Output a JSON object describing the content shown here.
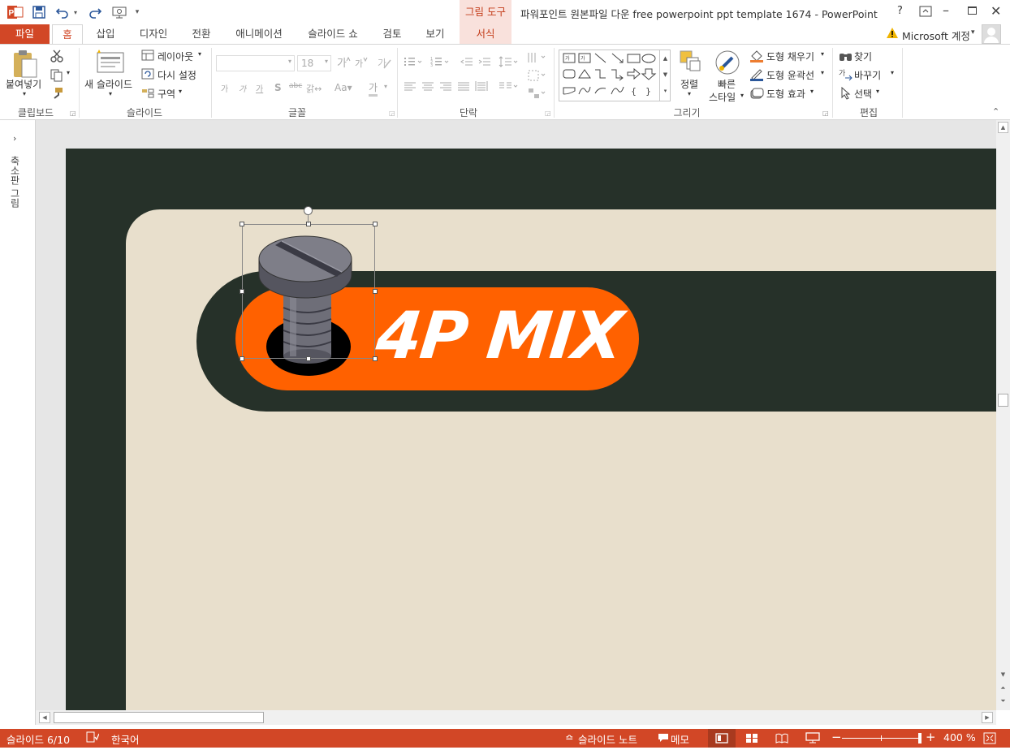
{
  "app": {
    "title": "파워포인트 원본파일 다운 free powerpoint ppt template 1674 - PowerPoint",
    "contextual_group": "그림 도구",
    "help": "?",
    "account": "Microsoft 계정"
  },
  "tabs": {
    "file": "파일",
    "home": "홈",
    "insert": "삽입",
    "design": "디자인",
    "transitions": "전환",
    "animations": "애니메이션",
    "slideshow": "슬라이드 쇼",
    "review": "검토",
    "view": "보기",
    "format": "서식"
  },
  "ribbon": {
    "clipboard": {
      "label": "클립보드",
      "paste": "붙여넣기"
    },
    "slides": {
      "label": "슬라이드",
      "new_slide": "새 슬라이드",
      "layout": "레이아웃",
      "reset": "다시 설정",
      "section": "구역"
    },
    "font": {
      "label": "글꼴",
      "size": "18"
    },
    "paragraph": {
      "label": "단락"
    },
    "drawing": {
      "label": "그리기",
      "arrange": "정렬",
      "quick_styles_1": "빠른",
      "quick_styles_2": "스타일",
      "shape_fill": "도형 채우기",
      "shape_outline": "도형 윤곽선",
      "shape_effects": "도형 효과"
    },
    "editing": {
      "label": "편집",
      "find": "찾기",
      "replace": "바꾸기",
      "select": "선택"
    }
  },
  "thumbnails_label": "축소판 그림",
  "slide": {
    "logo_text": "4P MIX"
  },
  "status": {
    "slide_counter": "슬라이드 6/10",
    "language": "한국어",
    "notes": "슬라이드 노트",
    "comments": "메모",
    "zoom": "400 %"
  },
  "colors": {
    "accent": "#d24726",
    "slide_dark": "#263129",
    "slide_cream": "#e8dfcc",
    "orange": "#ff6100"
  }
}
